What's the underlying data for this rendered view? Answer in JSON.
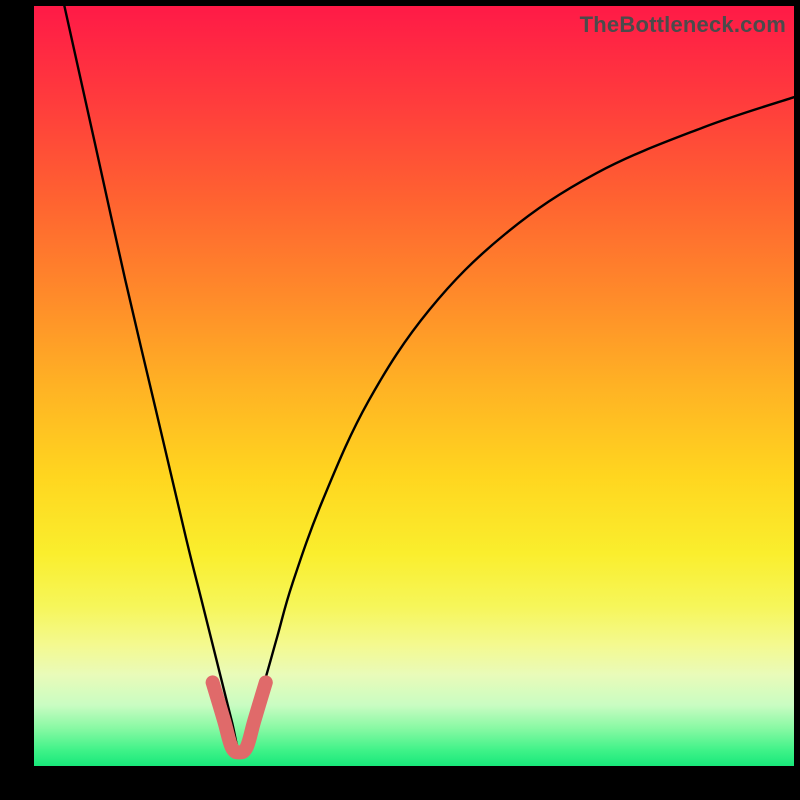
{
  "watermark": "TheBottleneck.com",
  "chart_data": {
    "type": "line",
    "title": "",
    "xlabel": "",
    "ylabel": "",
    "xlim": [
      0,
      100
    ],
    "ylim": [
      0,
      100
    ],
    "grid": false,
    "legend": null,
    "description": "Bottleneck curve: V-shaped black curve over a vertical red-to-green gradient. Minimum is highlighted with a short thick salmon segment near x≈27.",
    "series": [
      {
        "name": "bottleneck_curve",
        "color": "#000000",
        "x": [
          4,
          8,
          12,
          16,
          20,
          22,
          24,
          26,
          27,
          28,
          30,
          32,
          34,
          38,
          44,
          52,
          62,
          74,
          88,
          100
        ],
        "values": [
          100,
          82,
          64,
          47,
          30,
          22,
          14,
          6,
          2,
          4,
          10,
          17,
          24,
          35,
          48,
          60,
          70,
          78,
          84,
          88
        ]
      },
      {
        "name": "optimal_highlight",
        "color": "#e06a6a",
        "x": [
          23.5,
          25,
          26,
          27,
          28,
          29,
          30.5
        ],
        "values": [
          11,
          6,
          2.5,
          1.8,
          2.5,
          6,
          11
        ]
      }
    ],
    "gradient_stops": [
      {
        "pos": 0,
        "color": "#ff1a47"
      },
      {
        "pos": 50,
        "color": "#ffb224"
      },
      {
        "pos": 80,
        "color": "#f6f65a"
      },
      {
        "pos": 100,
        "color": "#18e87a"
      }
    ]
  }
}
